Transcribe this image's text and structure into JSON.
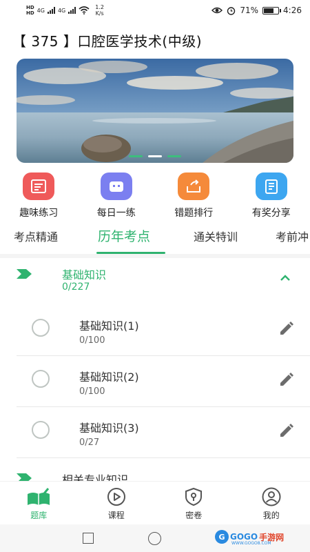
{
  "status_bar": {
    "network_labels": [
      "HD",
      "HD"
    ],
    "signal_labels": [
      "4G",
      "4G"
    ],
    "speed_value": "1.2",
    "speed_unit": "K/s",
    "battery": "71%",
    "time": "4:26",
    "battery_fraction": 0.71
  },
  "header": {
    "title": "【 375 】口腔医学技术(中级)"
  },
  "banner": {
    "slide_count": 3,
    "active_slide": 1
  },
  "quick_menu": [
    {
      "label": "趣味练习",
      "icon": "clipboard-icon",
      "color": "#ef5a5a"
    },
    {
      "label": "每日一练",
      "icon": "robot-icon",
      "color": "#7b7ff0"
    },
    {
      "label": "错题排行",
      "icon": "box-share-icon",
      "color": "#f58a3a"
    },
    {
      "label": "有奖分享",
      "icon": "notebook-icon",
      "color": "#3da6f0"
    }
  ],
  "tabs": [
    {
      "label": "考点精通"
    },
    {
      "label": "历年考点",
      "active": true
    },
    {
      "label": "通关特训"
    },
    {
      "label": "考前冲"
    }
  ],
  "tree": {
    "sections": [
      {
        "title": "基础知识",
        "count": "0/227",
        "expanded": true,
        "items": [
          {
            "title": "基础知识(1)",
            "count": "0/100"
          },
          {
            "title": "基础知识(2)",
            "count": "0/100"
          },
          {
            "title": "基础知识(3)",
            "count": "0/27"
          }
        ]
      },
      {
        "title": "相关专业知识",
        "count": "",
        "expanded": false,
        "items": []
      }
    ]
  },
  "bottom_nav": [
    {
      "label": "题库",
      "icon": "book-icon",
      "active": true
    },
    {
      "label": "课程",
      "icon": "play-icon"
    },
    {
      "label": "密卷",
      "icon": "shield-key-icon"
    },
    {
      "label": "我的",
      "icon": "user-icon"
    }
  ],
  "watermark": {
    "logo": "G",
    "brand": "GOGO",
    "brand_suffix": "手游网",
    "url": "WWW.GOGO8.COM"
  },
  "colors": {
    "accent": "#2fb36f",
    "divider": "#e8e8e8"
  }
}
